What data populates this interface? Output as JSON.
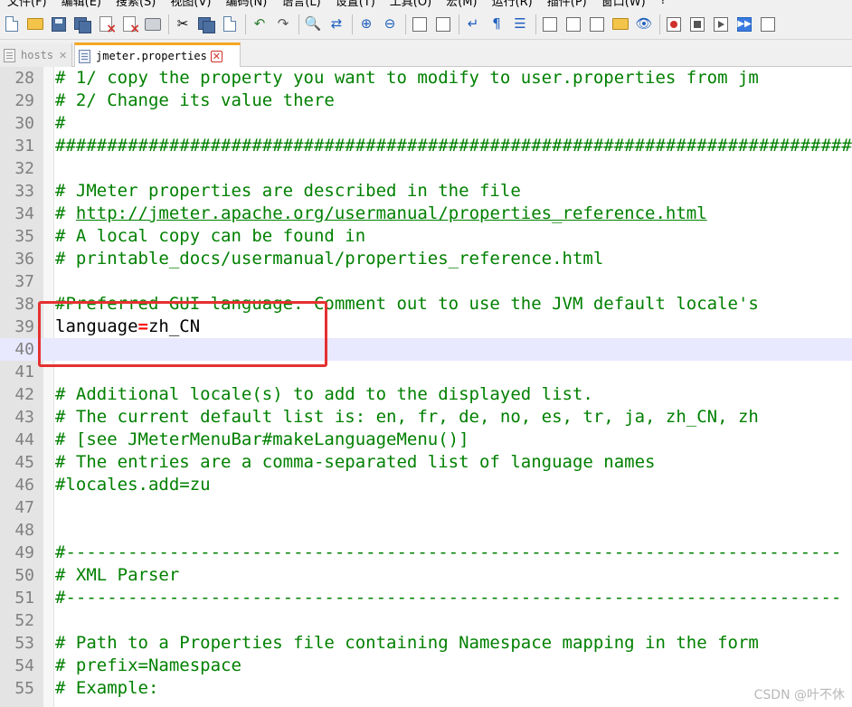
{
  "menubar": {
    "items": [
      "文件(F)",
      "编辑(E)",
      "搜索(S)",
      "视图(V)",
      "编码(N)",
      "语言(L)",
      "设置(T)",
      "工具(O)",
      "宏(M)",
      "运行(R)",
      "插件(P)",
      "窗口(W)",
      "?"
    ]
  },
  "toolbar": {
    "icons": [
      "new-file-icon",
      "open-folder-icon",
      "save-icon",
      "save-all-icon",
      "close-file-icon",
      "close-all-icon",
      "print-icon",
      "cut-icon",
      "copy-icon",
      "paste-icon",
      "undo-icon",
      "redo-icon",
      "find-icon",
      "replace-icon",
      "zoom-in-icon",
      "zoom-out-icon",
      "sync-vertical-icon",
      "sync-horizontal-icon",
      "word-wrap-icon",
      "show-all-chars-icon",
      "indent-guide-icon",
      "language-icon",
      "doc-map-icon",
      "function-list-icon",
      "folder-workspace-icon",
      "monitor-icon",
      "record-macro-icon",
      "stop-macro-icon",
      "play-macro-icon",
      "run-macro-multiple-icon",
      "save-macro-icon"
    ]
  },
  "tabs": [
    {
      "label": "hosts",
      "active": false
    },
    {
      "label": "jmeter.properties",
      "active": true
    }
  ],
  "editor": {
    "current_line": 40,
    "lines": [
      {
        "n": "28",
        "text": "# 1/ copy the property you want to modify to user.properties from jm",
        "type": "comment"
      },
      {
        "n": "29",
        "text": "# 2/ Change its value there",
        "type": "comment"
      },
      {
        "n": "30",
        "text": "#",
        "type": "comment"
      },
      {
        "n": "31",
        "text": "################################################################################",
        "type": "comment"
      },
      {
        "n": "32",
        "text": "",
        "type": "blank"
      },
      {
        "n": "33",
        "text": "# JMeter properties are described in the file",
        "type": "comment"
      },
      {
        "n": "34",
        "prefix": "# ",
        "link": "http://jmeter.apache.org/usermanual/properties_reference.html",
        "type": "link"
      },
      {
        "n": "35",
        "text": "# A local copy can be found in",
        "type": "comment"
      },
      {
        "n": "36",
        "text": "# printable_docs/usermanual/properties_reference.html",
        "type": "comment"
      },
      {
        "n": "37",
        "text": "",
        "type": "blank"
      },
      {
        "n": "38",
        "text": "#Preferred GUI language. Comment out to use the JVM default locale's",
        "type": "comment"
      },
      {
        "n": "39",
        "key": "language",
        "eq": "=",
        "value": "zh_CN",
        "type": "property"
      },
      {
        "n": "40",
        "text": "",
        "type": "blank"
      },
      {
        "n": "41",
        "text": "",
        "type": "blank"
      },
      {
        "n": "42",
        "text": "# Additional locale(s) to add to the displayed list.",
        "type": "comment"
      },
      {
        "n": "43",
        "text": "# The current default list is: en, fr, de, no, es, tr, ja, zh_CN, zh",
        "type": "comment"
      },
      {
        "n": "44",
        "text": "# [see JMeterMenuBar#makeLanguageMenu()]",
        "type": "comment"
      },
      {
        "n": "45",
        "text": "# The entries are a comma-separated list of language names",
        "type": "comment"
      },
      {
        "n": "46",
        "text": "#locales.add=zu",
        "type": "comment"
      },
      {
        "n": "47",
        "text": "",
        "type": "blank"
      },
      {
        "n": "48",
        "text": "",
        "type": "blank"
      },
      {
        "n": "49",
        "text": "#---------------------------------------------------------------------------",
        "type": "comment"
      },
      {
        "n": "50",
        "text": "# XML Parser",
        "type": "comment"
      },
      {
        "n": "51",
        "text": "#---------------------------------------------------------------------------",
        "type": "comment"
      },
      {
        "n": "52",
        "text": "",
        "type": "blank"
      },
      {
        "n": "53",
        "text": "# Path to a Properties file containing Namespace mapping in the form",
        "type": "comment"
      },
      {
        "n": "54",
        "text": "# prefix=Namespace",
        "type": "comment"
      },
      {
        "n": "55",
        "text": "# Example:",
        "type": "comment"
      }
    ]
  },
  "annotation": {
    "color": "#e53030",
    "target_line": 39
  },
  "colors": {
    "comment": "#008000",
    "operator": "#ff0000",
    "current_line": "#e8e8ff",
    "active_tab_accent": "#f5a623"
  },
  "watermark": "CSDN @叶不休"
}
